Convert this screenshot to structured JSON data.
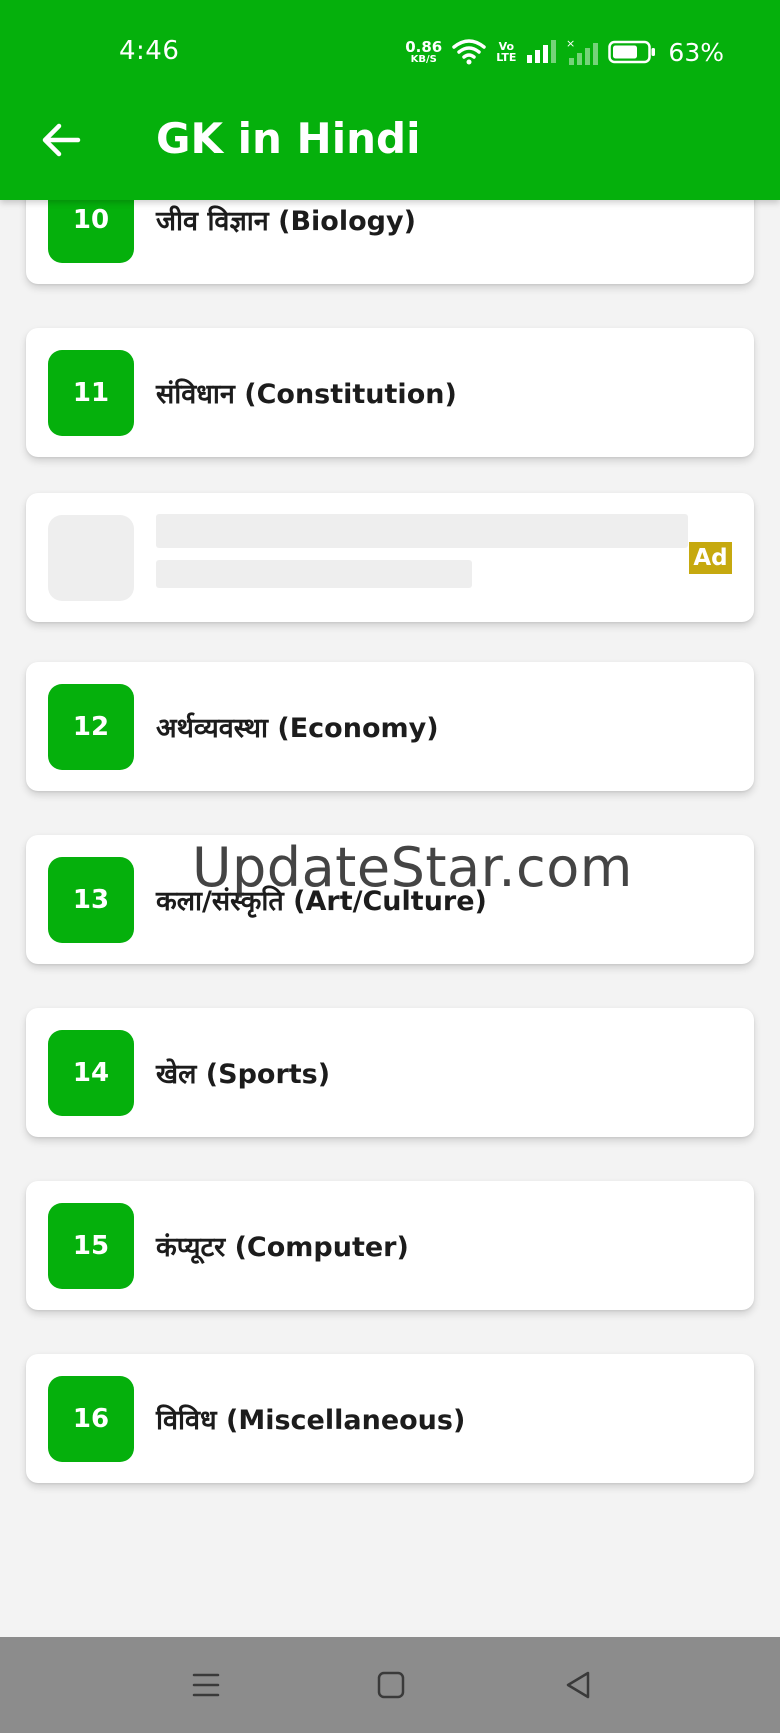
{
  "status_bar": {
    "time": "4:46",
    "net_speed_value": "0.86",
    "net_speed_unit": "KB/S",
    "volte_top": "Vo",
    "volte_bottom": "LTE",
    "battery_percent": "63%"
  },
  "app_bar": {
    "title": "GK in Hindi",
    "back_icon": "arrow-back-icon"
  },
  "topics": [
    {
      "number": "10",
      "label": "जीव विज्ञान (Biology)"
    },
    {
      "number": "11",
      "label": "संविधान (Constitution)"
    },
    {
      "number": "12",
      "label": "अर्थव्यवस्था (Economy)"
    },
    {
      "number": "13",
      "label": "कला/संस्कृति (Art/Culture)"
    },
    {
      "number": "14",
      "label": "खेल (Sports)"
    },
    {
      "number": "15",
      "label": "कंप्यूटर (Computer)"
    },
    {
      "number": "16",
      "label": "विविध (Miscellaneous)"
    }
  ],
  "ad": {
    "badge": "Ad"
  },
  "watermark": "UpdateStar.com",
  "nav_bar": {
    "icons": [
      "menu-icon",
      "home-square-icon",
      "back-triangle-icon"
    ]
  },
  "colors": {
    "accent": "#05b00c",
    "ad_badge": "#c6a90f",
    "background": "#f3f3f3"
  }
}
